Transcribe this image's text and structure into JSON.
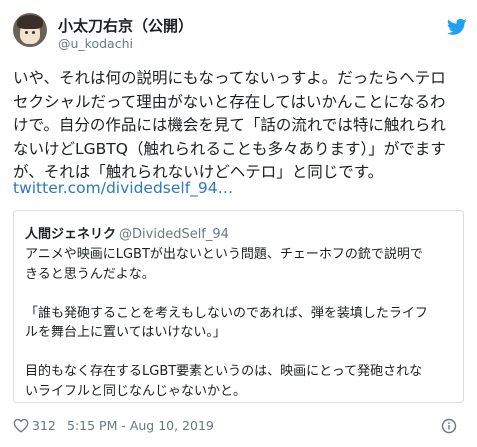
{
  "author": {
    "display_name": "小太刀右京（公開）",
    "handle": "@u_kodachi"
  },
  "icons": {
    "brand": "twitter-bird-icon",
    "like": "heart-icon",
    "info": "info-icon",
    "brand_color": "#1da1f2"
  },
  "tweet": {
    "lines": [
      "いや、それは何の説明にもなってないっすよ。だったらヘテロ",
      "セクシャルだって理由がないと存在してはいかんことになるわ",
      "けで。自分の作品には機会を見て「話の流れでは特に触れられ",
      "ないけどLGBTQ（触れられることも多々あります）」がでます",
      "が、それは「触れられないけどヘテロ」と同じです。"
    ],
    "link": "twitter.com/dividedself_94…"
  },
  "quoted_tweet": {
    "display_name": "人間ジェネリク",
    "handle": "@DividedSelf_94",
    "lines": [
      "アニメや映画にLGBTが出ないという問題、チェーホフの銃で説明で",
      "きると思うんだよな。",
      "",
      "「誰も発砲することを考えもしないのであれば、弾を装填したライフ",
      "ルを舞台上に置いてはいけない。」",
      "",
      "目的もなく存在するLGBT要素というのは、映画にとって発砲されな",
      "いライフルと同じなんじゃないかと。"
    ]
  },
  "footer": {
    "like_count": "312",
    "timestamp": "5:15 PM - Aug 10, 2019"
  }
}
